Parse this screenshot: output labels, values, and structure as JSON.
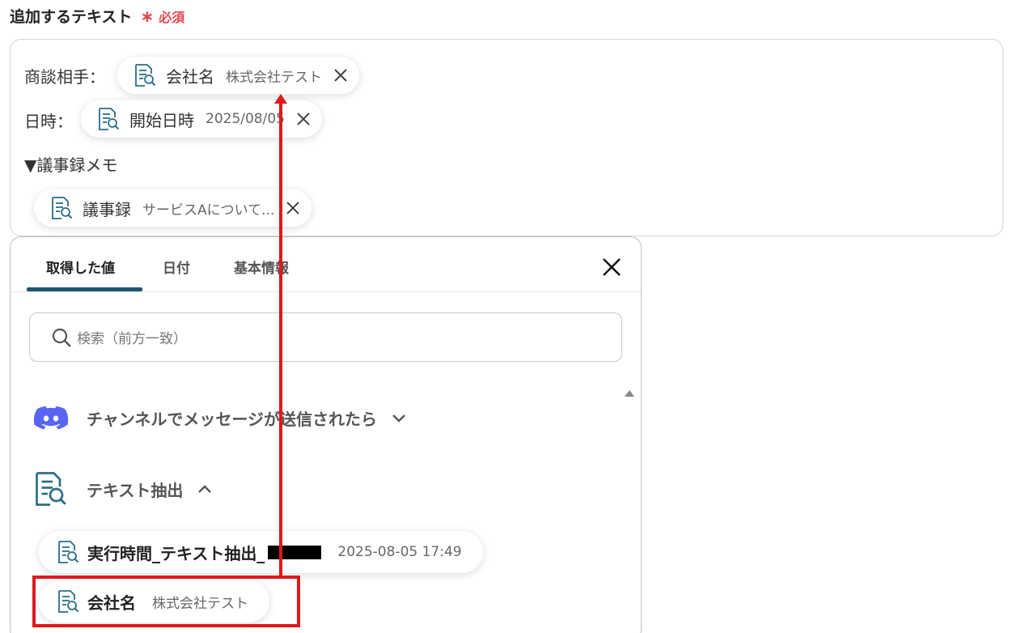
{
  "field": {
    "label": "追加するテキスト",
    "required_mark": "∗",
    "required_text": "必須"
  },
  "editor": {
    "line1_prefix": "商談相手：",
    "line2_prefix": "日時：",
    "line3_text": "▼議事録メモ",
    "pills": [
      {
        "name": "会社名",
        "value": "株式会社テスト"
      },
      {
        "name": "開始日時",
        "value": "2025/08/05"
      },
      {
        "name": "議事録",
        "value": "サービスAについて..."
      }
    ]
  },
  "panel": {
    "tabs": [
      {
        "label": "取得した値"
      },
      {
        "label": "日付"
      },
      {
        "label": "基本情報"
      }
    ],
    "search_placeholder": "検索（前方一致）",
    "sections": [
      {
        "label": "チャンネルでメッセージが送信されたら",
        "icon": "discord-icon",
        "expanded": false
      },
      {
        "label": "テキスト抽出",
        "icon": "document-search-icon",
        "expanded": true
      }
    ],
    "items": [
      {
        "name": "実行時間_テキスト抽出_",
        "value": "2025-08-05 17:49"
      },
      {
        "name": "会社名",
        "value": "株式会社テスト"
      }
    ]
  },
  "colors": {
    "accent": "#1e5570",
    "icon_teal": "#2b6e86",
    "required": "#e5484d",
    "annotation": "#e0181c",
    "discord": "#5865f2"
  }
}
